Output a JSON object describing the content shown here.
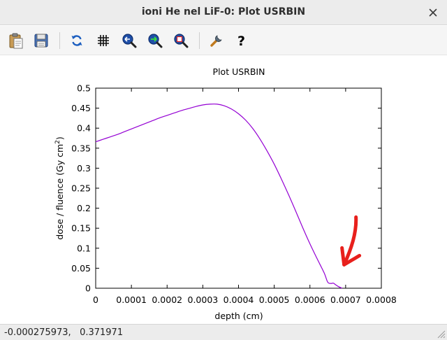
{
  "window": {
    "title": "ioni He nel LiF-0: Plot USRBIN"
  },
  "toolbar": {
    "buttons": [
      {
        "name": "clipboard-icon"
      },
      {
        "name": "save-icon"
      },
      {
        "name": "refresh-icon"
      },
      {
        "name": "grid-icon"
      },
      {
        "name": "zoom-out-icon"
      },
      {
        "name": "zoom-in-icon"
      },
      {
        "name": "zoom-fit-icon"
      },
      {
        "name": "settings-wrench-icon"
      },
      {
        "name": "help-icon"
      }
    ]
  },
  "chart_data": {
    "type": "line",
    "title": "Plot USRBIN",
    "xlabel": "depth (cm)",
    "ylabel_main": "dose / fluence (Gy cm",
    "ylabel_sup": "2",
    "ylabel_close": ")",
    "xlim": [
      0,
      0.0008
    ],
    "ylim": [
      0,
      0.5
    ],
    "xticks": [
      "0",
      "0.0001",
      "0.0002",
      "0.0003",
      "0.0004",
      "0.0005",
      "0.0006",
      "0.0007",
      "0.0008"
    ],
    "yticks": [
      "0",
      "0.05",
      "0.1",
      "0.15",
      "0.2",
      "0.25",
      "0.3",
      "0.35",
      "0.4",
      "0.45",
      "0.5"
    ],
    "grid": false,
    "line_color": "#9400d3",
    "annotation": {
      "type": "arrow",
      "color": "#e8201c",
      "points_to_x": 0.00068,
      "points_to_y": 0.05
    },
    "series": [
      {
        "x": [
          0,
          2e-05,
          4e-05,
          6e-05,
          8e-05,
          0.0001,
          0.00012,
          0.00014,
          0.00016,
          0.00018,
          0.0002,
          0.00022,
          0.00024,
          0.00026,
          0.00028,
          0.0003,
          0.00032,
          0.00034,
          0.00036,
          0.00038,
          0.0004,
          0.00042,
          0.00044,
          0.00046,
          0.00048,
          0.0005,
          0.00052,
          0.00054,
          0.00056,
          0.00058,
          0.0006,
          0.00062,
          0.00064,
          0.00065,
          0.00066,
          0.000665,
          0.00067,
          0.00068,
          0.00069
        ],
        "y": [
          0.366,
          0.372,
          0.378,
          0.384,
          0.391,
          0.398,
          0.405,
          0.412,
          0.419,
          0.426,
          0.432,
          0.438,
          0.444,
          0.449,
          0.454,
          0.458,
          0.46,
          0.46,
          0.456,
          0.448,
          0.436,
          0.42,
          0.399,
          0.373,
          0.343,
          0.31,
          0.273,
          0.234,
          0.193,
          0.151,
          0.111,
          0.074,
          0.038,
          0.015,
          0.012,
          0.013,
          0.01,
          0.004,
          0
        ]
      }
    ]
  },
  "status": {
    "coords": "-0.000275973,   0.371971"
  }
}
